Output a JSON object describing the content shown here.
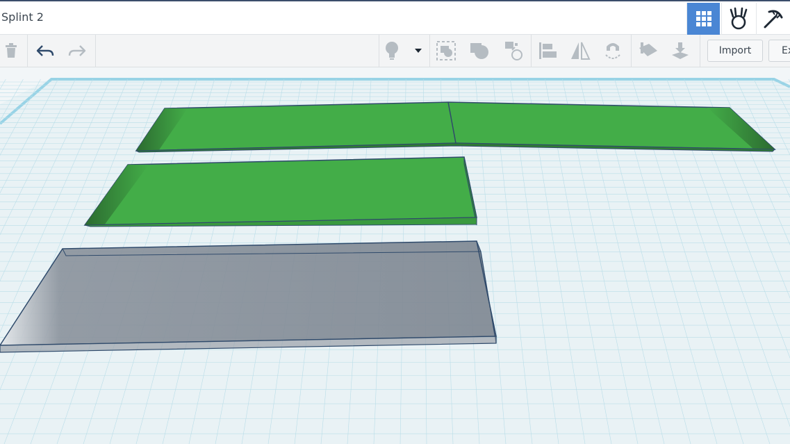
{
  "window": {
    "title": "Splint 2"
  },
  "views": [
    {
      "id": "3d-design",
      "icon": "grid-icon",
      "active": true
    },
    {
      "id": "blocks",
      "icon": "codeblocks-icon",
      "active": false
    },
    {
      "id": "bricks",
      "icon": "pickaxe-icon",
      "active": false
    }
  ],
  "toolbar": {
    "left_tools": [
      "trash-icon",
      "undo-icon",
      "redo-icon"
    ],
    "right_tools": [
      "light-bulb-icon",
      "dropdown-arrow-icon",
      "group-icon",
      "union-shape-icon",
      "ungroup-icon",
      "align-icon",
      "mirror-icon",
      "magnet-icon",
      "workplane-icon",
      "drop-icon"
    ],
    "import_label": "Import",
    "export_label": "Ex"
  },
  "colors": {
    "accent": "#4a86d4",
    "solid": "#43ad48",
    "hole": "#8c949f",
    "grid": "#b9dde8",
    "edge": "#2f4a6b"
  },
  "shapes": [
    {
      "name": "long-green-ramp",
      "type": "solid"
    },
    {
      "name": "short-green-ramp",
      "type": "solid"
    },
    {
      "name": "hole-box",
      "type": "hole"
    }
  ]
}
